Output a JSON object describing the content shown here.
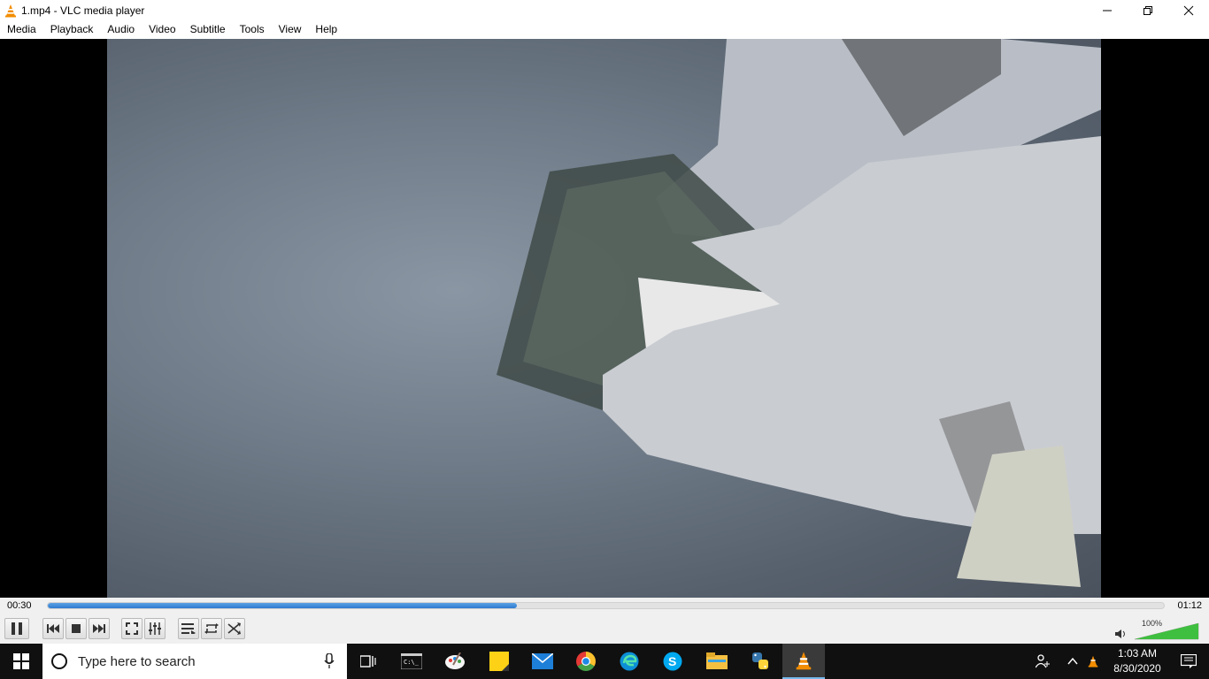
{
  "window": {
    "title": "1.mp4 - VLC media player"
  },
  "menu": [
    "Media",
    "Playback",
    "Audio",
    "Video",
    "Subtitle",
    "Tools",
    "View",
    "Help"
  ],
  "player": {
    "elapsed": "00:30",
    "total": "01:12",
    "progress_fraction": 0.42,
    "volume_label": "100%",
    "volume_fraction": 1.0,
    "state": "playing"
  },
  "taskbar": {
    "search_placeholder": "Type here to search",
    "time": "1:03 AM",
    "date": "8/30/2020",
    "apps": [
      "task-view-icon",
      "terminal-icon",
      "paint-icon",
      "sticky-notes-icon",
      "mail-icon",
      "chrome-icon",
      "edge-icon",
      "skype-icon",
      "file-explorer-icon",
      "python-icon",
      "vlc-icon"
    ]
  },
  "colors": {
    "seek_fill": "#2e7bcf",
    "volume_green": "#3fbf3f",
    "taskbar_bg": "#101010",
    "vlc_orange": "#f28c00"
  }
}
